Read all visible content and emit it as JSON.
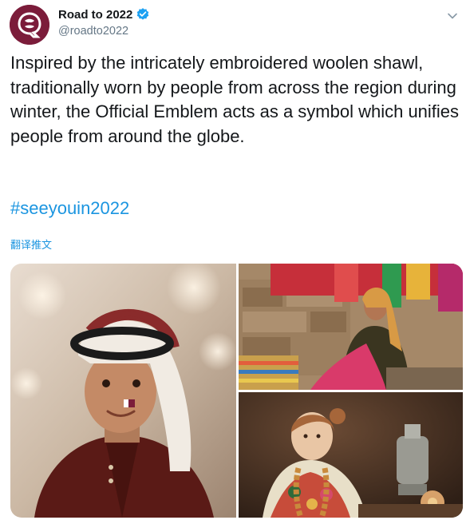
{
  "account": {
    "display_name": "Road to 2022",
    "handle": "@roadto2022",
    "avatar_icon": "qatar-2022-emblem-icon",
    "verified_icon": "verified-badge-icon",
    "brand_color": "#7b1c3a",
    "verified_color": "#1da1f2"
  },
  "menu": {
    "icon": "chevron-down-icon"
  },
  "tweet": {
    "text": "Inspired by the intricately embroidered woolen shawl, traditionally worn by people from across the region during winter, the Official Emblem acts as a symbol which unifies people from around the globe.",
    "hashtag": "#seeyouin2022",
    "translate_label": "翻译推文",
    "link_color": "#1b95e0"
  },
  "media": {
    "photos": [
      {
        "subject": "boy-in-headdress-photo"
      },
      {
        "subject": "woman-with-shawls-photo"
      },
      {
        "subject": "girl-with-shawl-photo"
      }
    ]
  }
}
